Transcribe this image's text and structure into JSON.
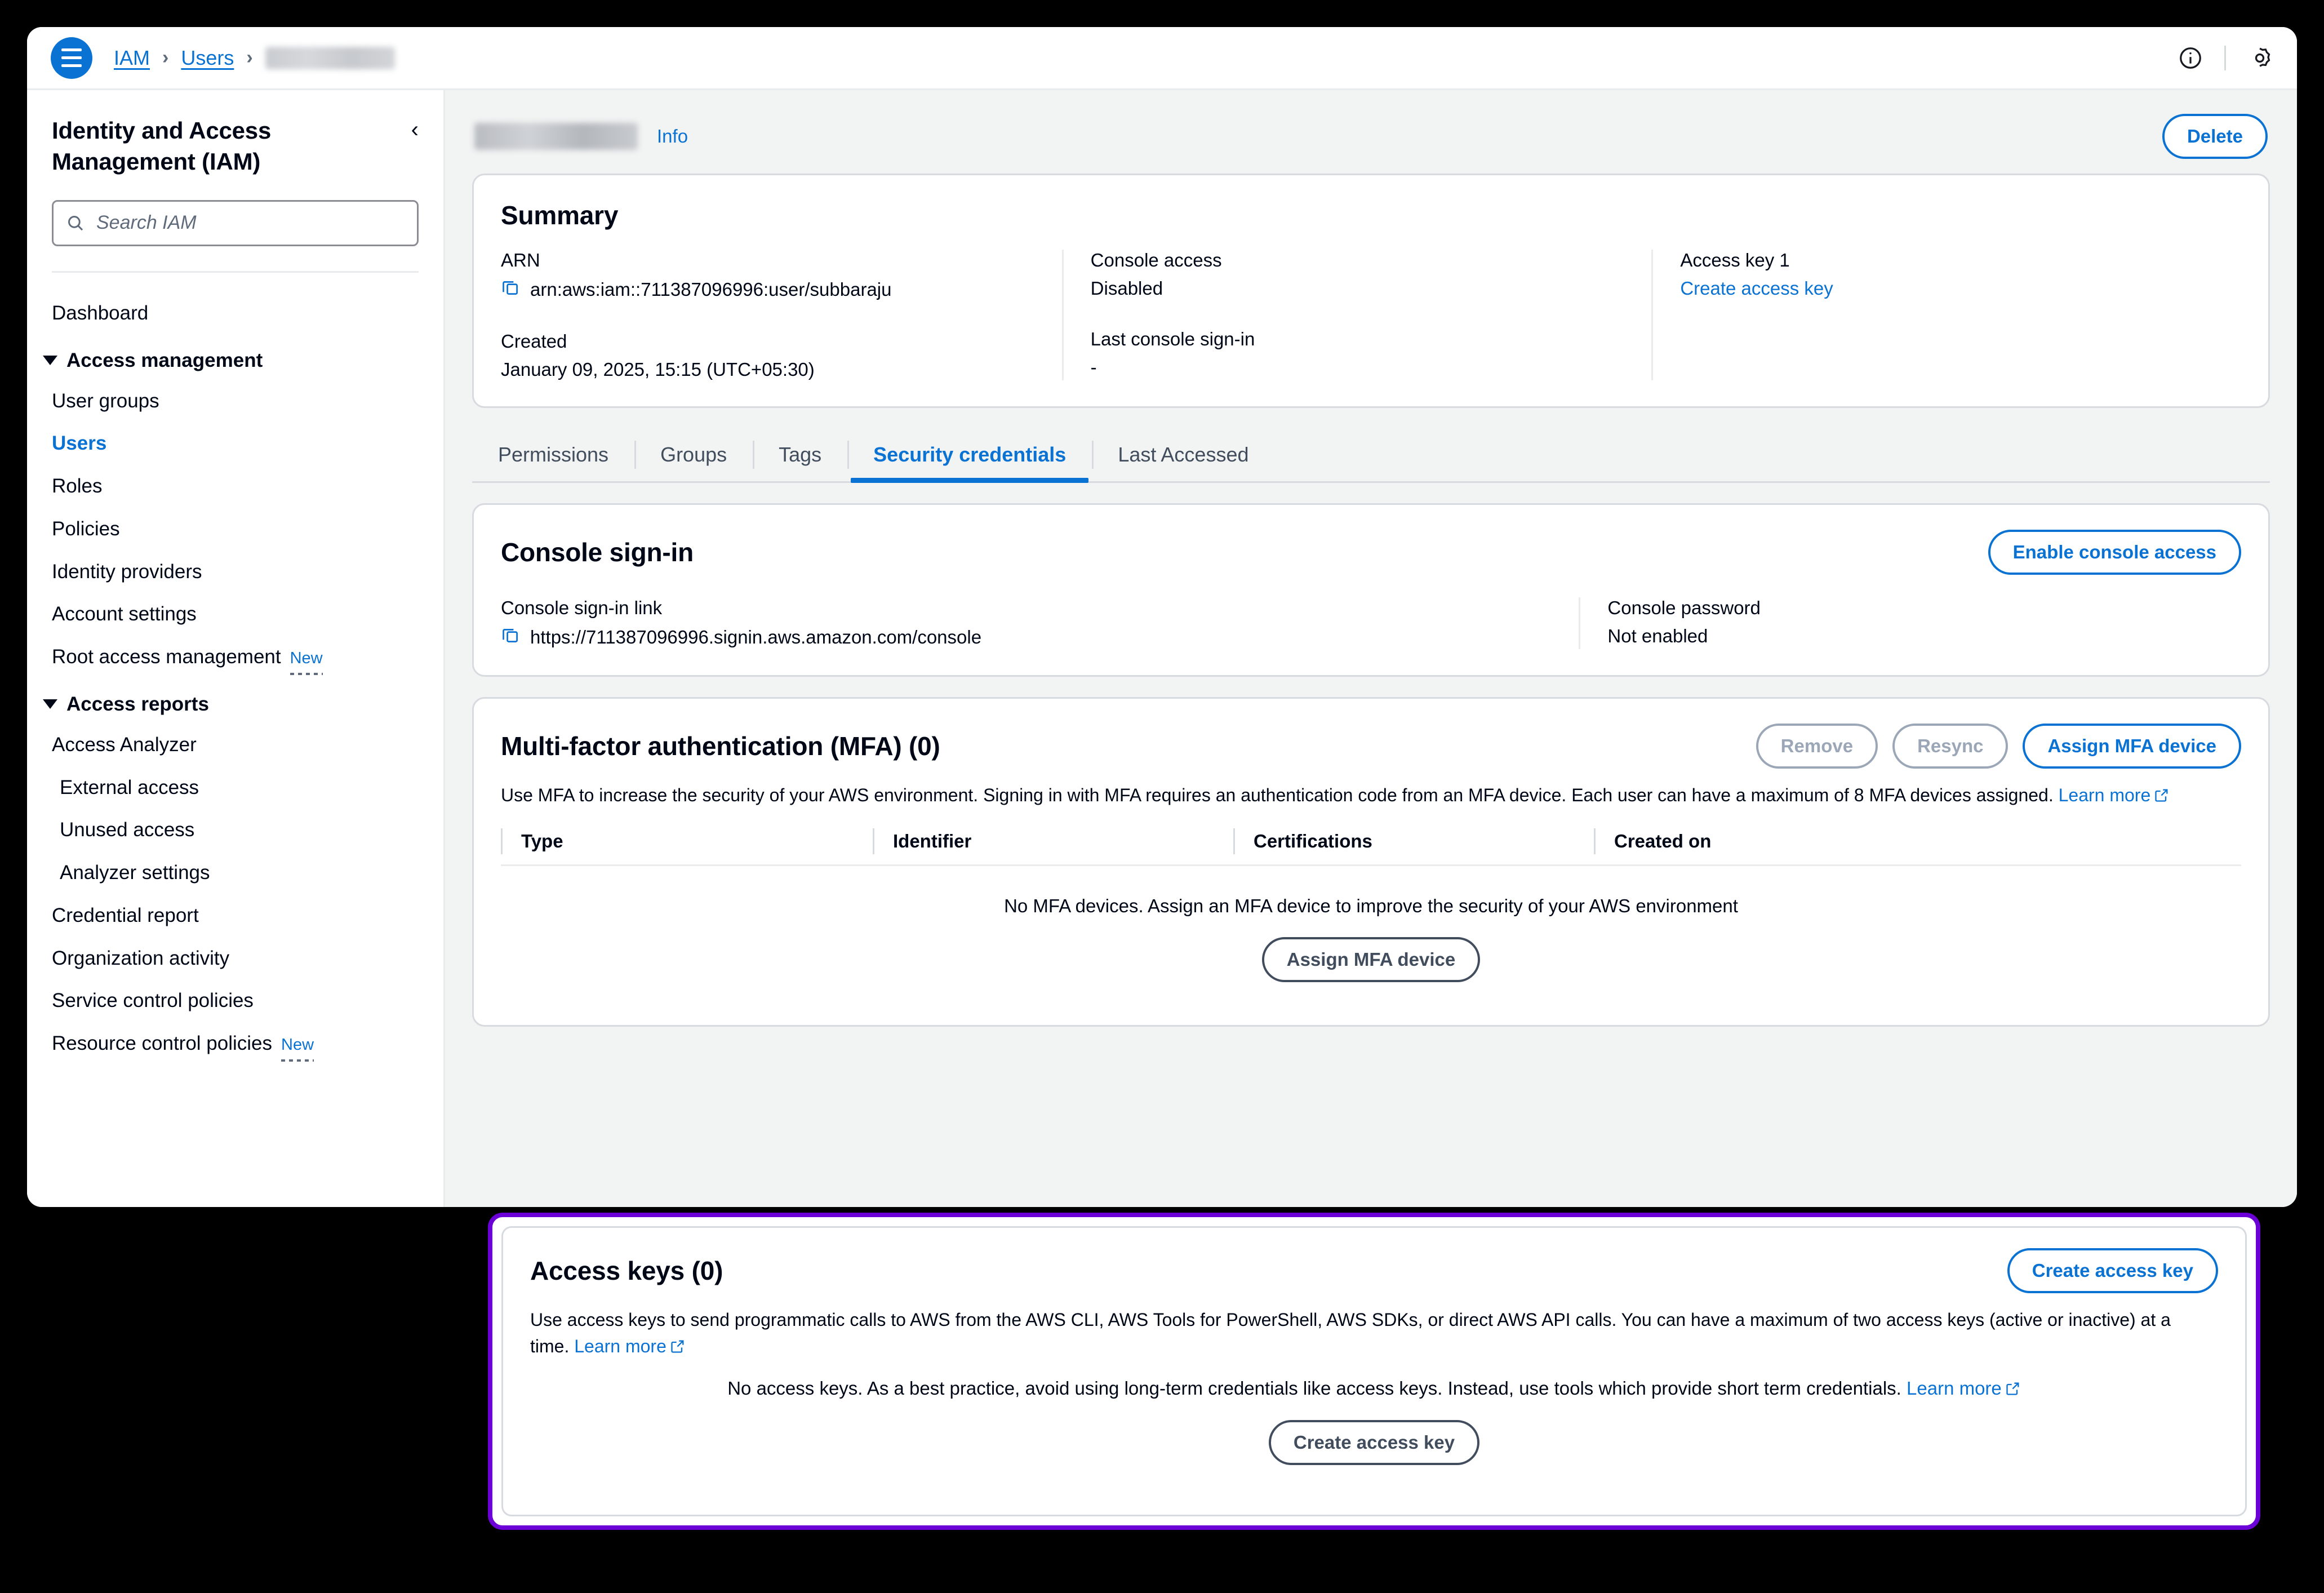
{
  "breadcrumb": {
    "menu_icon": "hamburger-menu-icon",
    "items": [
      {
        "label": "IAM",
        "type": "link"
      },
      {
        "label": "Users",
        "type": "link"
      },
      {
        "label": "",
        "type": "redacted"
      }
    ],
    "separator": "›"
  },
  "topbar": {
    "info_icon": "info-circle-icon",
    "settings_icon": "settings-gear-icon"
  },
  "sidebar": {
    "title": "Identity and Access Management (IAM)",
    "collapse_icon": "chevron-left-icon",
    "search": {
      "icon": "search-icon",
      "placeholder": "Search IAM",
      "value": ""
    },
    "dashboard": "Dashboard",
    "groups": [
      {
        "label": "Access management",
        "expanded": true,
        "items": [
          {
            "label": "User groups",
            "active": false,
            "indent": 0
          },
          {
            "label": "Users",
            "active": true,
            "indent": 0
          },
          {
            "label": "Roles",
            "active": false,
            "indent": 0
          },
          {
            "label": "Policies",
            "active": false,
            "indent": 0
          },
          {
            "label": "Identity providers",
            "active": false,
            "indent": 0
          },
          {
            "label": "Account settings",
            "active": false,
            "indent": 0
          },
          {
            "label": "Root access management",
            "active": false,
            "indent": 0,
            "badge": "New"
          }
        ]
      },
      {
        "label": "Access reports",
        "expanded": true,
        "items": [
          {
            "label": "Access Analyzer",
            "active": false,
            "indent": 0
          },
          {
            "label": "External access",
            "active": false,
            "indent": 1
          },
          {
            "label": "Unused access",
            "active": false,
            "indent": 1
          },
          {
            "label": "Analyzer settings",
            "active": false,
            "indent": 1
          },
          {
            "label": "Credential report",
            "active": false,
            "indent": 0
          },
          {
            "label": "Organization activity",
            "active": false,
            "indent": 0
          },
          {
            "label": "Service control policies",
            "active": false,
            "indent": 0
          },
          {
            "label": "Resource control policies",
            "active": false,
            "indent": 0,
            "badge": "New"
          }
        ]
      }
    ]
  },
  "page": {
    "title_redacted": true,
    "info_link": "Info",
    "delete_button": "Delete"
  },
  "summary": {
    "title": "Summary",
    "arn_label": "ARN",
    "arn_value": "arn:aws:iam::711387096996:user/subbaraju",
    "created_label": "Created",
    "created_value": "January 09, 2025, 15:15 (UTC+05:30)",
    "console_access_label": "Console access",
    "console_access_value": "Disabled",
    "last_signin_label": "Last console sign-in",
    "last_signin_value": "-",
    "access_key_label": "Access key 1",
    "access_key_link": "Create access key",
    "copy_icon": "copy-icon"
  },
  "tabs": [
    {
      "label": "Permissions",
      "active": false
    },
    {
      "label": "Groups",
      "active": false
    },
    {
      "label": "Tags",
      "active": false
    },
    {
      "label": "Security credentials",
      "active": true
    },
    {
      "label": "Last Accessed",
      "active": false
    }
  ],
  "console_signin": {
    "title": "Console sign-in",
    "enable_button": "Enable console access",
    "link_label": "Console sign-in link",
    "link_value": "https://711387096996.signin.aws.amazon.com/console",
    "password_label": "Console password",
    "password_value": "Not enabled",
    "copy_icon": "copy-icon"
  },
  "mfa": {
    "title": "Multi-factor authentication (MFA) (0)",
    "remove_button": "Remove",
    "resync_button": "Resync",
    "assign_button": "Assign MFA device",
    "description": "Use MFA to increase the security of your AWS environment. Signing in with MFA requires an authentication code from an MFA device. Each user can have a maximum of 8 MFA devices assigned.",
    "learn_more": "Learn more",
    "external_icon": "external-link-icon",
    "columns": [
      "Type",
      "Identifier",
      "Certifications",
      "Created on"
    ],
    "rows": [],
    "empty_text": "No MFA devices. Assign an MFA device to improve the security of your AWS environment",
    "empty_button": "Assign MFA device"
  },
  "access_keys": {
    "title": "Access keys (0)",
    "create_button": "Create access key",
    "description": "Use access keys to send programmatic calls to AWS from the AWS CLI, AWS Tools for PowerShell, AWS SDKs, or direct AWS API calls. You can have a maximum of two access keys (active or inactive) at a time.",
    "learn_more": "Learn more",
    "external_icon": "external-link-icon",
    "empty_text": "No access keys. As a best practice, avoid using long-term credentials like access keys. Instead, use tools which provide short term credentials.",
    "empty_learn_more": "Learn more",
    "empty_button": "Create access key",
    "highlight_color": "#6b00d7"
  },
  "colors": {
    "accent_blue": "#0972d3",
    "text_primary": "#000716",
    "text_secondary": "#414d5c",
    "border": "#d7dade",
    "page_bg": "#f2f3f3",
    "highlight_purple": "#6b00d7"
  }
}
